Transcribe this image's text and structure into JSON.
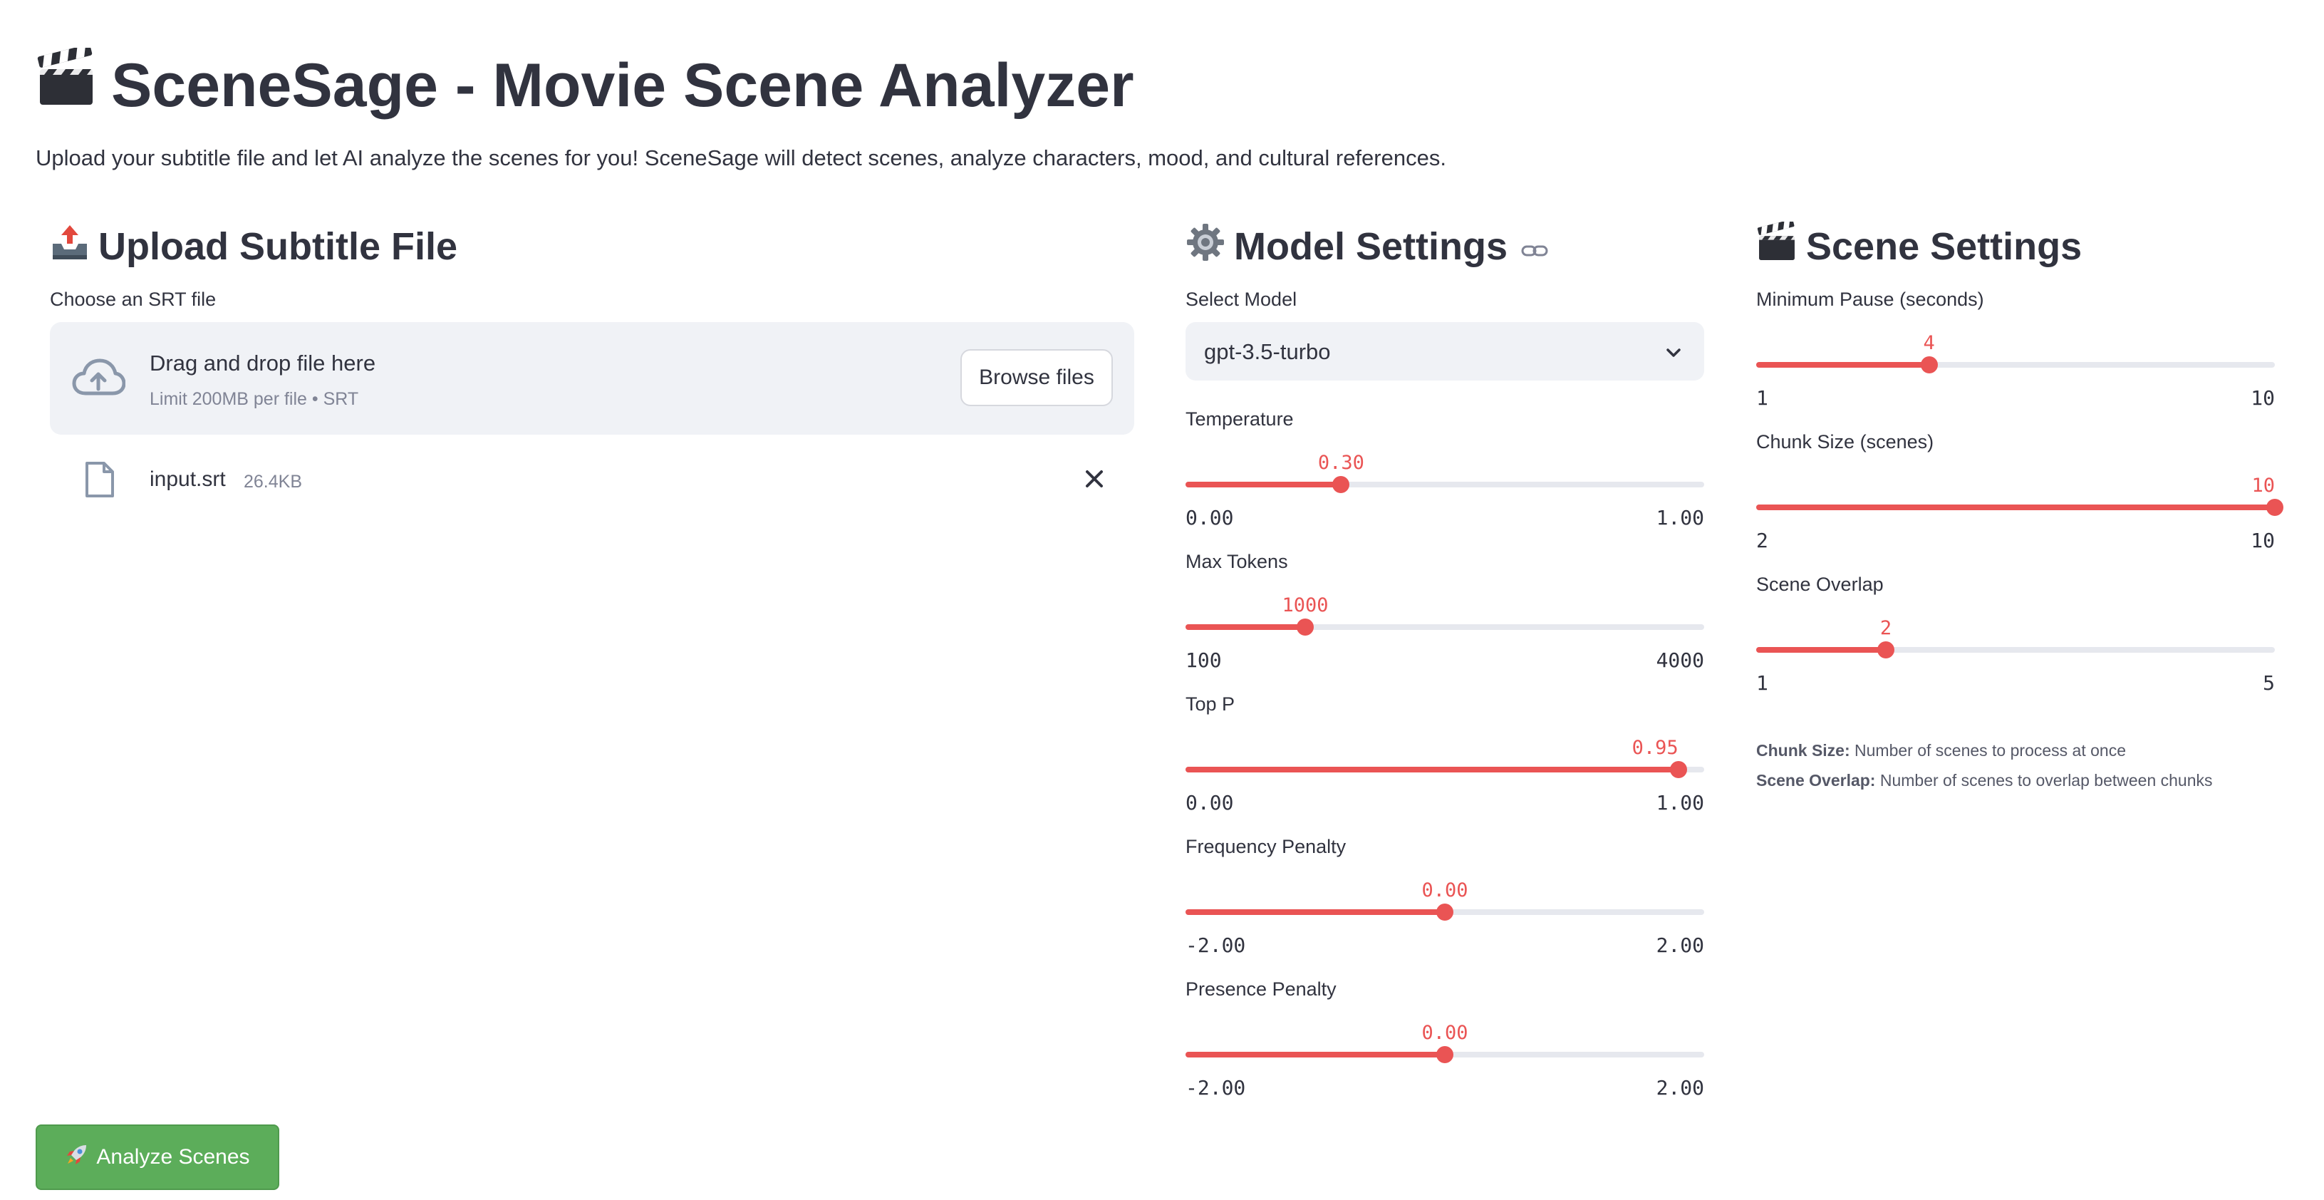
{
  "header": {
    "title": "SceneSage - Movie Scene Analyzer",
    "subtitle": "Upload your subtitle file and let AI analyze the scenes for you! SceneSage will detect scenes, analyze characters, mood, and cultural references.",
    "title_icon": "clapper-board-icon"
  },
  "upload": {
    "heading": "Upload Subtitle File",
    "heading_icon": "outbox-tray-icon",
    "label": "Choose an SRT file",
    "drop_text": "Drag and drop file here",
    "limit_text": "Limit 200MB per file • SRT",
    "browse_label": "Browse files",
    "file": {
      "name": "input.srt",
      "size": "26.4KB"
    }
  },
  "model": {
    "heading": "Model Settings",
    "heading_icon": "gear-icon",
    "select_label": "Select Model",
    "selected_model": "gpt-3.5-turbo",
    "sliders": [
      {
        "label": "Temperature",
        "value": "0.30",
        "min": "0.00",
        "max": "1.00",
        "fraction": 0.3
      },
      {
        "label": "Max Tokens",
        "value": "1000",
        "min": "100",
        "max": "4000",
        "fraction": 0.2308
      },
      {
        "label": "Top P",
        "value": "0.95",
        "min": "0.00",
        "max": "1.00",
        "fraction": 0.95
      },
      {
        "label": "Frequency Penalty",
        "value": "0.00",
        "min": "-2.00",
        "max": "2.00",
        "fraction": 0.5
      },
      {
        "label": "Presence Penalty",
        "value": "0.00",
        "min": "-2.00",
        "max": "2.00",
        "fraction": 0.5
      }
    ]
  },
  "scene": {
    "heading": "Scene Settings",
    "heading_icon": "clapper-board-icon",
    "sliders": [
      {
        "label": "Minimum Pause (seconds)",
        "value": "4",
        "min": "1",
        "max": "10",
        "fraction": 0.3333
      },
      {
        "label": "Chunk Size (scenes)",
        "value": "10",
        "min": "2",
        "max": "10",
        "fraction": 1.0
      },
      {
        "label": "Scene Overlap",
        "value": "2",
        "min": "1",
        "max": "5",
        "fraction": 0.25
      }
    ],
    "help": [
      {
        "term": "Chunk Size:",
        "text": " Number of scenes to process at once"
      },
      {
        "term": "Scene Overlap:",
        "text": " Number of scenes to overlap between chunks"
      }
    ]
  },
  "actions": {
    "analyze_label": "Analyze Scenes",
    "analyze_icon": "rocket-icon"
  },
  "colors": {
    "accent": "#ea5454",
    "track": "#e6e8ee",
    "button_green": "#5cad5a",
    "text": "#31333f"
  }
}
